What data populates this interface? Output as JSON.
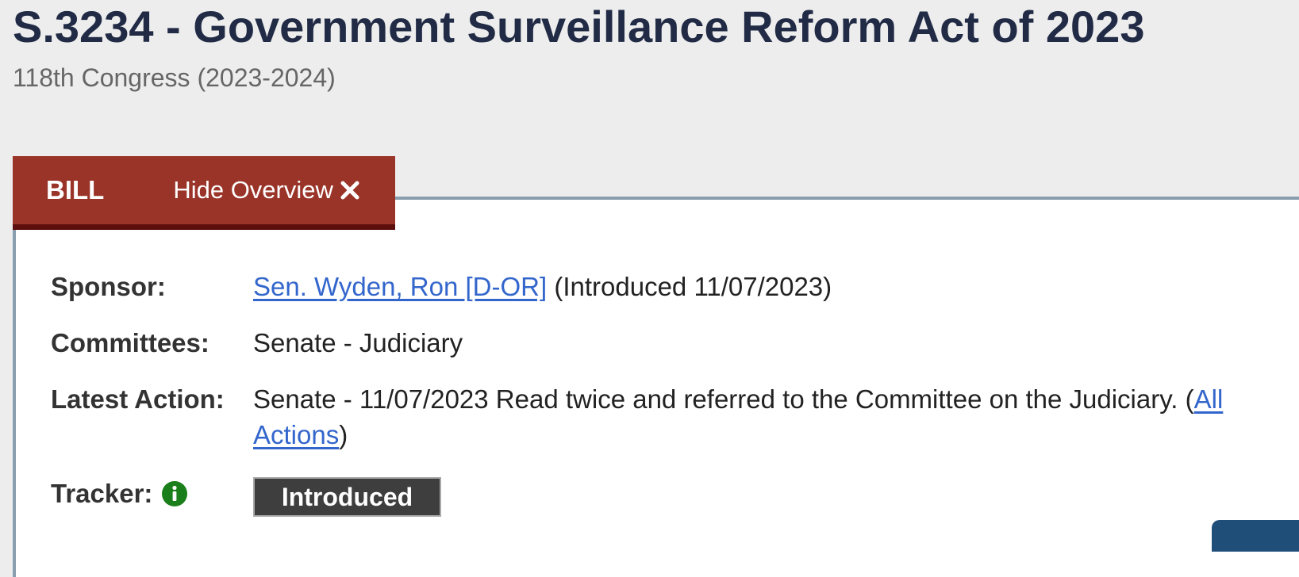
{
  "header": {
    "title": "S.3234 - Government Surveillance Reform Act of 2023",
    "congress": "118th Congress (2023-2024)"
  },
  "tabs": {
    "bill_label": "BILL",
    "hide_overview_label": "Hide Overview",
    "close_icon": "close-icon"
  },
  "overview": {
    "sponsor": {
      "label": "Sponsor:",
      "name": "Sen. Wyden, Ron [D-OR]",
      "introduced": " (Introduced 11/07/2023)"
    },
    "committees": {
      "label": "Committees:",
      "value": "Senate - Judiciary"
    },
    "latest_action": {
      "label": "Latest Action:",
      "text": "Senate - 11/07/2023 Read twice and referred to the Committee on the Judiciary.  (",
      "link_label": "All Actions",
      "suffix": ")"
    },
    "tracker": {
      "label": "Tracker:",
      "info_icon": "info-icon",
      "status": "Introduced"
    }
  },
  "colors": {
    "title": "#212b45",
    "tab_background": "#9a3429",
    "tab_border": "#5c0f0c",
    "panel_border": "#889eae",
    "link": "#3366cc",
    "info_icon": "#1a7f1a",
    "tracker_badge": "#3e3e3e"
  }
}
